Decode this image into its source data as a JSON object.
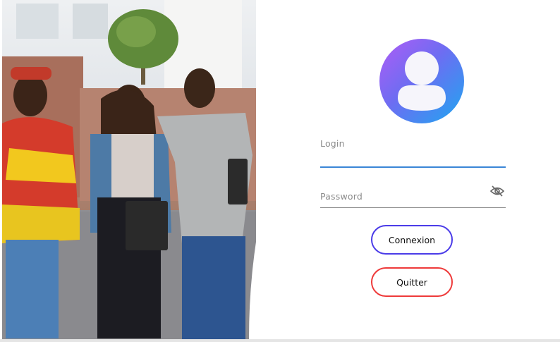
{
  "window": {
    "title": ""
  },
  "login": {
    "login_label": "Login",
    "password_label": "Password",
    "password_toggle_icon": "eye-off-icon",
    "avatar_icon": "user-icon"
  },
  "buttons": {
    "connexion_label": "Connexion",
    "quitter_label": "Quitter"
  },
  "colors": {
    "avatar_gradient_start": "#b05cf5",
    "avatar_gradient_end": "#1ea7f0",
    "login_underline": "#3a86d6",
    "connexion_border": "#4b3ce8",
    "quitter_border": "#ee3a3a"
  }
}
